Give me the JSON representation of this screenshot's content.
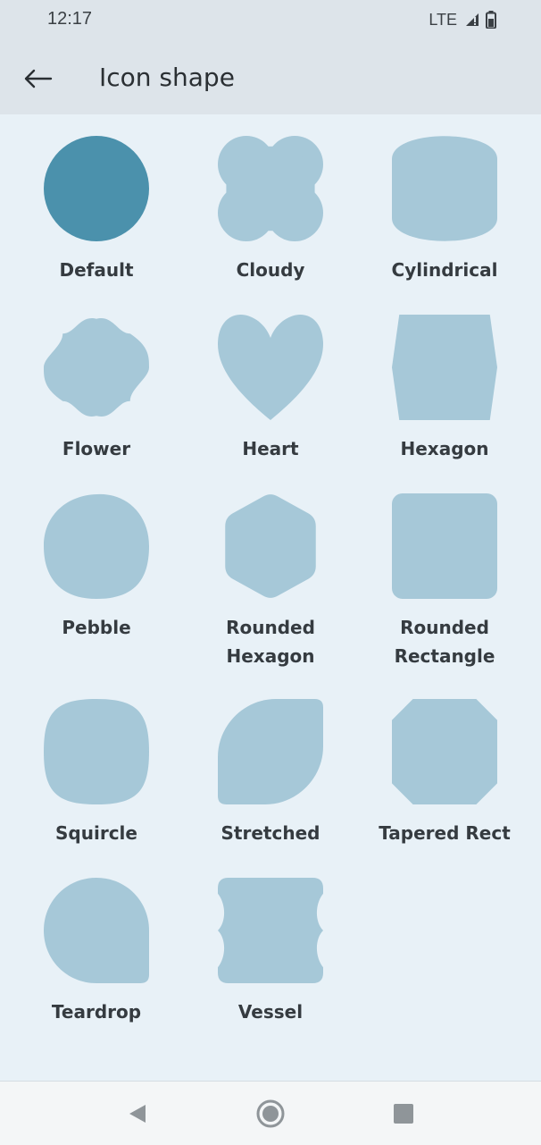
{
  "status_bar": {
    "time": "12:17",
    "network": "LTE",
    "signal_icon": "signal-icon",
    "battery_icon": "battery-icon"
  },
  "app_bar": {
    "title": "Icon shape",
    "back_icon": "arrow-back-icon"
  },
  "shapes": {
    "selected": "Default",
    "selected_color": "#4b91ac",
    "unselected_color": "#a6c8d8",
    "items": [
      {
        "label": "Default",
        "label2": ""
      },
      {
        "label": "Cloudy",
        "label2": ""
      },
      {
        "label": "Cylindrical",
        "label2": ""
      },
      {
        "label": "Flower",
        "label2": ""
      },
      {
        "label": "Heart",
        "label2": ""
      },
      {
        "label": "Hexagon",
        "label2": ""
      },
      {
        "label": "Pebble",
        "label2": ""
      },
      {
        "label": "Rounded",
        "label2": "Hexagon"
      },
      {
        "label": "Rounded",
        "label2": "Rectangle"
      },
      {
        "label": "Squircle",
        "label2": ""
      },
      {
        "label": "Stretched",
        "label2": ""
      },
      {
        "label": "Tapered Rect",
        "label2": ""
      },
      {
        "label": "Teardrop",
        "label2": ""
      },
      {
        "label": "Vessel",
        "label2": ""
      }
    ]
  },
  "nav_bar": {
    "back_icon": "nav-back-icon",
    "home_icon": "nav-home-icon",
    "recents_icon": "nav-recents-icon"
  }
}
